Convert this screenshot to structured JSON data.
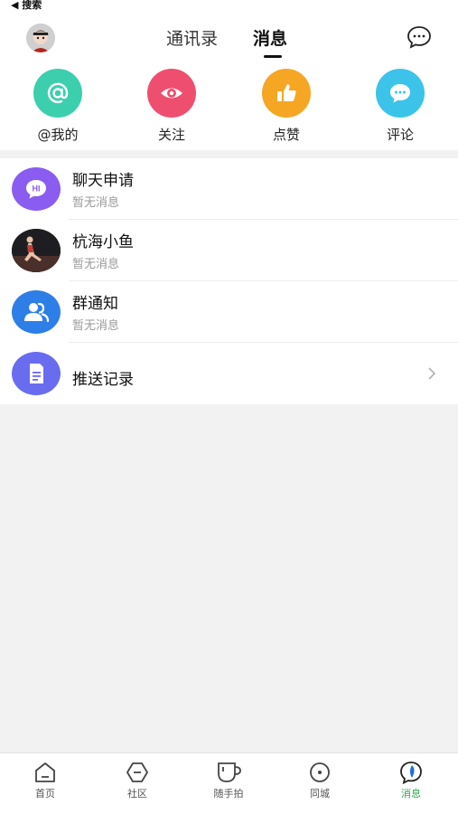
{
  "status_bar": {
    "back_text": "◀ 搜索"
  },
  "header": {
    "tabs": [
      {
        "label": "通讯录",
        "active": false
      },
      {
        "label": "消息",
        "active": true
      }
    ]
  },
  "quick_actions": [
    {
      "label": "@我的",
      "icon": "at-icon",
      "color": "#3ccfae"
    },
    {
      "label": "关注",
      "icon": "eye-icon",
      "color": "#ee4f6f"
    },
    {
      "label": "点赞",
      "icon": "thumbs-up-icon",
      "color": "#f5a623"
    },
    {
      "label": "评论",
      "icon": "comment-icon",
      "color": "#3cc3ea"
    }
  ],
  "message_list": [
    {
      "title": "聊天申请",
      "subtitle": "暂无消息",
      "icon": "hi-chat-icon",
      "color": "#8a5cf0"
    },
    {
      "title": "杭海小鱼",
      "subtitle": "暂无消息",
      "icon": "user-avatar"
    },
    {
      "title": "群通知",
      "subtitle": "暂无消息",
      "icon": "group-icon",
      "color": "#2e7ee8"
    },
    {
      "title": "推送记录",
      "icon": "document-icon",
      "color": "#6a6cf0"
    }
  ],
  "bottom_tabs": [
    {
      "label": "首页",
      "active": false
    },
    {
      "label": "社区",
      "active": false
    },
    {
      "label": "随手拍",
      "active": false
    },
    {
      "label": "同城",
      "active": false
    },
    {
      "label": "消息",
      "active": true
    }
  ],
  "colors": {
    "active_tab": "#2aa64e",
    "background": "#f2f2f2"
  }
}
